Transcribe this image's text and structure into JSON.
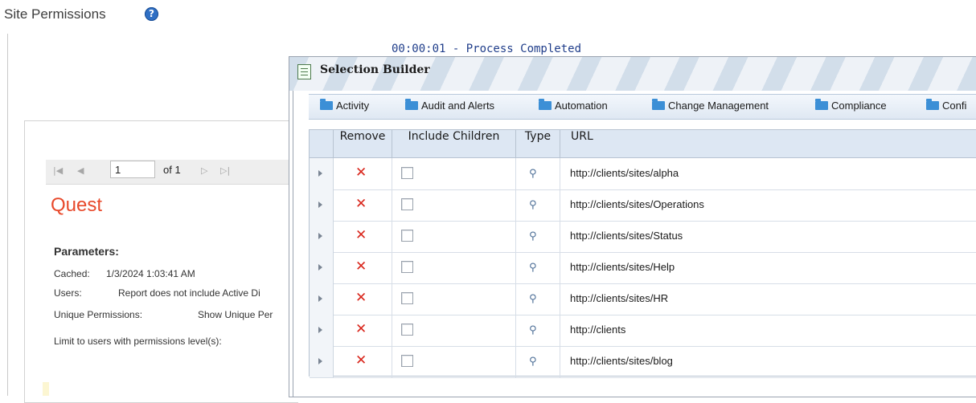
{
  "page": {
    "title": "Site Permissions",
    "help_icon": "question-circle-icon",
    "status": "00:00:01 - Process Completed"
  },
  "report": {
    "toolbar": {
      "page_value": "1",
      "of_label": "of 1"
    },
    "logo_text": "Quest",
    "parameters_heading": "Parameters:",
    "parameters": [
      {
        "label": "Cached:",
        "value": "1/3/2024 1:03:41 AM"
      },
      {
        "label": "Users:",
        "value": "Report does not include Active Di"
      },
      {
        "label": "Unique Permissions:",
        "value": "Show Unique Per"
      },
      {
        "label": "Limit to users with permissions level(s):",
        "value": ""
      }
    ]
  },
  "dialog": {
    "title": "Selection Builder",
    "categories": [
      "Activity",
      "Audit and Alerts",
      "Automation",
      "Change Management",
      "Compliance",
      "Confi"
    ],
    "columns": {
      "remove": "Remove",
      "include_children": "Include Children",
      "type": "Type",
      "url": "URL"
    },
    "rows": [
      {
        "url": "http://clients/sites/alpha",
        "include_children": false
      },
      {
        "url": "http://clients/sites/Operations",
        "include_children": false
      },
      {
        "url": "http://clients/sites/Status",
        "include_children": false
      },
      {
        "url": "http://clients/sites/Help",
        "include_children": false
      },
      {
        "url": "http://clients/sites/HR",
        "include_children": false
      },
      {
        "url": "http://clients",
        "include_children": false
      },
      {
        "url": "http://clients/sites/blog",
        "include_children": false
      }
    ],
    "remove_glyph": "✕",
    "type_glyph": "⚲"
  },
  "colors": {
    "accent": "#2f6fc4",
    "remove": "#d9261c",
    "logo": "#e8492b",
    "folder": "#3c8fd6"
  }
}
